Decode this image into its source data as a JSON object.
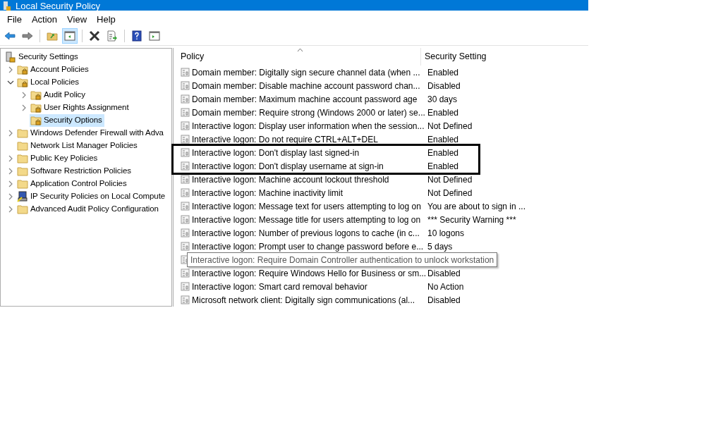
{
  "window": {
    "title": "Local Security Policy"
  },
  "menu": [
    "File",
    "Action",
    "View",
    "Help"
  ],
  "toolbar": [
    {
      "kind": "back",
      "pressed": false
    },
    {
      "kind": "forward",
      "pressed": false
    },
    {
      "kind": "sep"
    },
    {
      "kind": "up",
      "pressed": false
    },
    {
      "kind": "pane",
      "pressed": true
    },
    {
      "kind": "sep"
    },
    {
      "kind": "delete",
      "pressed": false
    },
    {
      "kind": "export",
      "pressed": false
    },
    {
      "kind": "sep"
    },
    {
      "kind": "help",
      "pressed": false
    },
    {
      "kind": "pane2",
      "pressed": false
    }
  ],
  "tree": {
    "label": "Security Settings",
    "children": [
      {
        "label": "Account Policies",
        "kind": "lockfolder",
        "expanded": false,
        "selected": false
      },
      {
        "label": "Local Policies",
        "kind": "lockfolder",
        "expanded": true,
        "selected": false,
        "children": [
          {
            "label": "Audit Policy",
            "kind": "lockfolder",
            "expanded": false,
            "selected": false
          },
          {
            "label": "User Rights Assignment",
            "kind": "lockfolder",
            "expanded": false,
            "selected": false
          },
          {
            "label": "Security Options",
            "kind": "lockfolder",
            "selected": true
          }
        ]
      },
      {
        "label": "Windows Defender Firewall with Adva",
        "kind": "folder",
        "expanded": false,
        "selected": false
      },
      {
        "label": "Network List Manager Policies",
        "kind": "folder",
        "selected": false
      },
      {
        "label": "Public Key Policies",
        "kind": "folder",
        "expanded": false,
        "selected": false
      },
      {
        "label": "Software Restriction Policies",
        "kind": "folder",
        "expanded": false,
        "selected": false
      },
      {
        "label": "Application Control Policies",
        "kind": "folder",
        "expanded": false,
        "selected": false
      },
      {
        "label": "IP Security Policies on Local Compute",
        "kind": "computer",
        "expanded": false,
        "selected": false
      },
      {
        "label": "Advanced Audit Policy Configuration",
        "kind": "folder",
        "expanded": false,
        "selected": false
      }
    ]
  },
  "table": {
    "columns": [
      "Policy",
      "Security Setting"
    ],
    "rows": [
      {
        "policy": "Domain member: Digitally sign secure channel data (when ...",
        "setting": "Enabled",
        "highlighted": false
      },
      {
        "policy": "Domain member: Disable machine account password chan...",
        "setting": "Disabled",
        "highlighted": false
      },
      {
        "policy": "Domain member: Maximum machine account password age",
        "setting": "30 days",
        "highlighted": false
      },
      {
        "policy": "Domain member: Require strong (Windows 2000 or later) se...",
        "setting": "Enabled",
        "highlighted": false
      },
      {
        "policy": "Interactive logon: Display user information when the session...",
        "setting": "Not Defined",
        "highlighted": false
      },
      {
        "policy": "Interactive logon: Do not require CTRL+ALT+DEL",
        "setting": "Enabled",
        "highlighted": false
      },
      {
        "policy": "Interactive logon: Don't display last signed-in",
        "setting": "Enabled",
        "highlighted": true
      },
      {
        "policy": "Interactive logon: Don't display username at sign-in",
        "setting": "Enabled",
        "highlighted": true
      },
      {
        "policy": "Interactive logon: Machine account lockout threshold",
        "setting": "Not Defined",
        "highlighted": false
      },
      {
        "policy": "Interactive logon: Machine inactivity limit",
        "setting": "Not Defined",
        "highlighted": false
      },
      {
        "policy": "Interactive logon: Message text for users attempting to log on",
        "setting": "You are about to sign in ...",
        "highlighted": false
      },
      {
        "policy": "Interactive logon: Message title for users attempting to log on",
        "setting": "***  Security Warning  ***",
        "highlighted": false
      },
      {
        "policy": "Interactive logon: Number of previous logons to cache (in c...",
        "setting": "10 logons",
        "highlighted": false
      },
      {
        "policy": "Interactive logon: Prompt user to change password before e...",
        "setting": "5 days",
        "highlighted": false
      },
      {
        "tooltip": "Interactive logon: Require Domain Controller authentication to unlock workstation",
        "highlighted": false
      },
      {
        "policy": "Interactive logon: Require Windows Hello for Business or sm...",
        "setting": "Disabled",
        "highlighted": false
      },
      {
        "policy": "Interactive logon: Smart card removal behavior",
        "setting": "No Action",
        "highlighted": false
      },
      {
        "policy": "Microsoft network client: Digitally sign communications (al...",
        "setting": "Disabled",
        "highlighted": false
      }
    ]
  }
}
